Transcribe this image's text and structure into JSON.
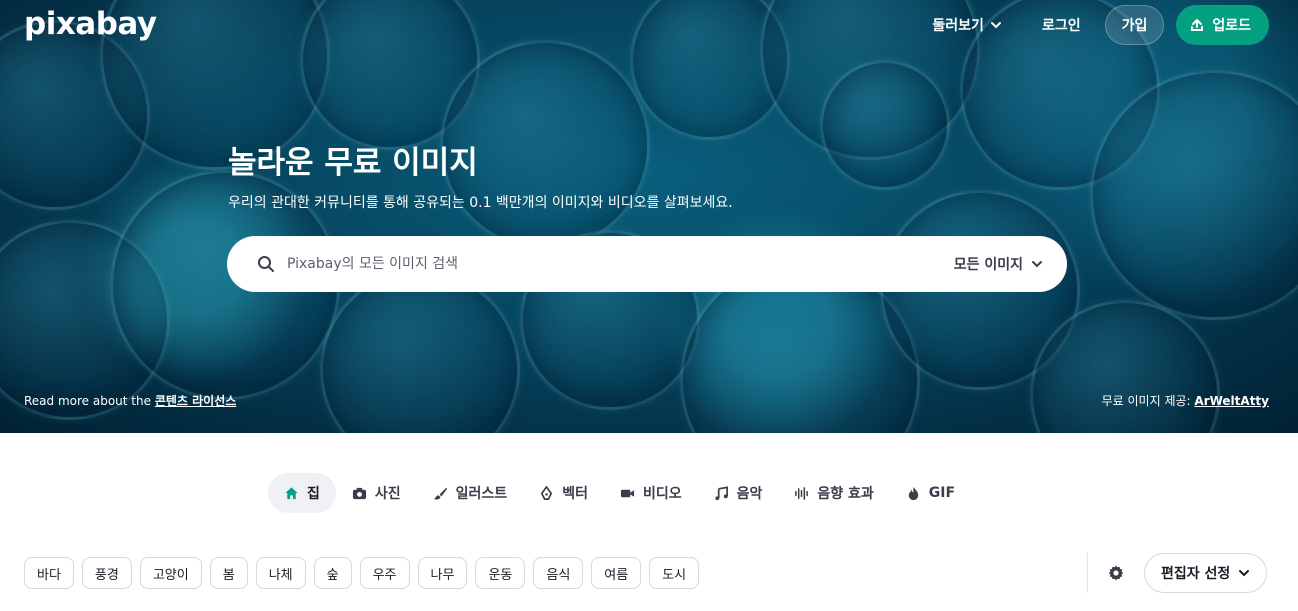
{
  "header": {
    "logo": "pixabay",
    "explore_label": "둘러보기",
    "login_label": "로그인",
    "join_label": "가입",
    "upload_label": "업로드",
    "upload_color": "#05a081"
  },
  "hero": {
    "title": "놀라운 무료 이미지",
    "subtitle": "우리의 관대한 커뮤니티를 통해 공유되는 0.1 백만개의 이미지와 비디오를 살펴보세요.",
    "search_placeholder": "Pixabay의 모든 이미지 검색",
    "search_type": "모든 이미지",
    "license_prefix": "Read more about the ",
    "license_link": "콘텐츠 라이선스",
    "credit_prefix": "무료 이미지 제공: ",
    "credit_author": "ArWeltAtty"
  },
  "tabs": [
    {
      "label": "집",
      "icon": "home-icon",
      "active": true
    },
    {
      "label": "사진",
      "icon": "camera-icon"
    },
    {
      "label": "일러스트",
      "icon": "brush-icon"
    },
    {
      "label": "벡터",
      "icon": "pen-nib-icon"
    },
    {
      "label": "비디오",
      "icon": "video-icon"
    },
    {
      "label": "음악",
      "icon": "music-icon"
    },
    {
      "label": "음향 효과",
      "icon": "sound-wave-icon"
    },
    {
      "label": "GIF",
      "icon": "flame-icon"
    }
  ],
  "tags": [
    "바다",
    "풍경",
    "고양이",
    "봄",
    "나체",
    "숲",
    "우주",
    "나무",
    "운동",
    "음식",
    "여름",
    "도시"
  ],
  "sort": {
    "label": "편집자 선정",
    "settings_icon": "gear-icon"
  }
}
